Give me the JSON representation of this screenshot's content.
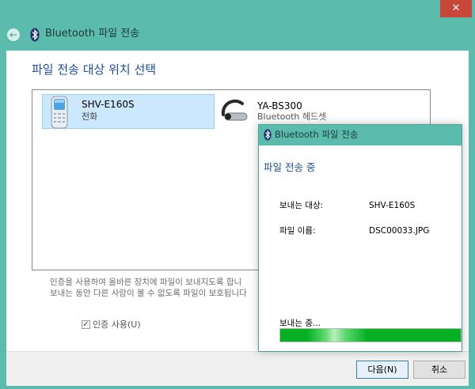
{
  "window": {
    "title": "Bluetooth 파일 전송",
    "close_glyph": "✕",
    "back_glyph": "←"
  },
  "main": {
    "heading": "파일 전송 대상 위치 선택",
    "devices": [
      {
        "name": "SHV-E160S",
        "type": "전화",
        "icon": "phone-icon",
        "selected": true
      },
      {
        "name": "YA-BS300",
        "type": "Bluetooth 헤드셋",
        "icon": "headset-icon",
        "selected": false
      }
    ],
    "help_line1": "인증을 사용하여 올바른 장치에 파일이 보내지도록 합니",
    "help_line2": "보내는 동안 다른 사람이 볼 수 없도록 파일이 보호됩니다",
    "auth_checkbox": {
      "label": "인증 사용(U)",
      "checked": true,
      "check_glyph": "✓"
    }
  },
  "buttons": {
    "next": "다음(N)",
    "cancel": "취소"
  },
  "progress_dialog": {
    "title": "Bluetooth 파일 전송",
    "heading": "파일 전송 중",
    "recipient_label": "보내는 대상:",
    "recipient_value": "SHV-E160S",
    "filename_label": "파일 이름:",
    "filename_value": "DSC00033.JPG",
    "status": "보내는 중...",
    "progress_percent": 100
  },
  "colors": {
    "accent": "#5bbcad",
    "heading_blue": "#1d4fa6",
    "close_red": "#c7483a",
    "progress_green": "#06b025"
  }
}
